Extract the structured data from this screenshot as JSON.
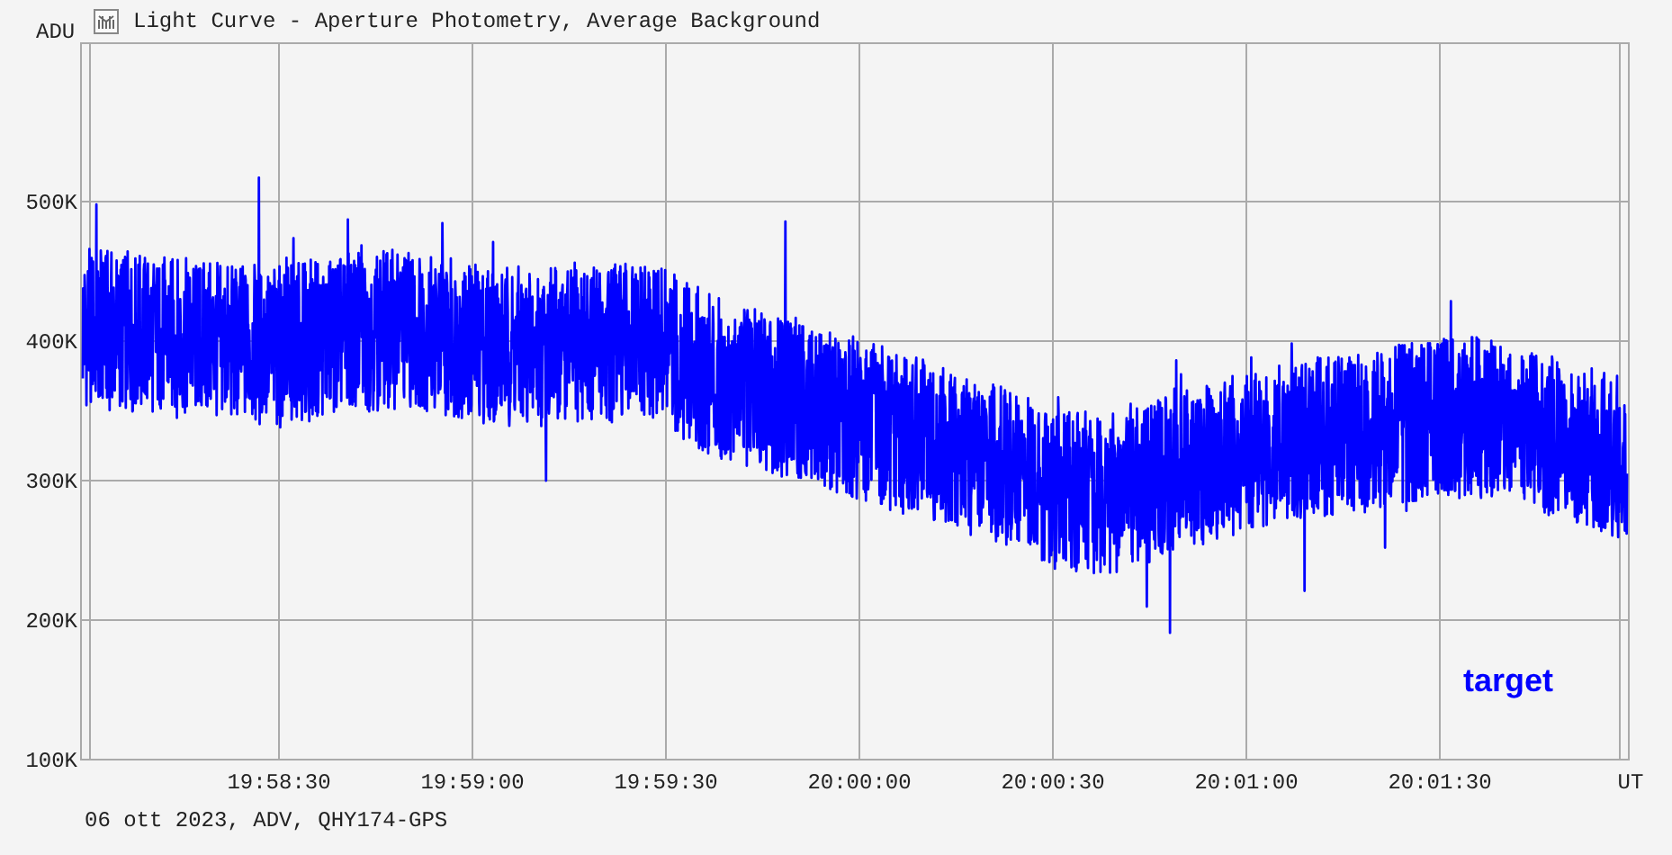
{
  "window": {
    "title": "Light Curve - Aperture Photometry, Average Background"
  },
  "chart": {
    "y_axis_title": "ADU",
    "x_axis_title": "UT",
    "y_tick_labels": [
      "500K",
      "400K",
      "300K",
      "200K",
      "100K"
    ],
    "x_tick_labels": [
      "19:58:30",
      "19:59:00",
      "19:59:30",
      "20:00:00",
      "20:00:30",
      "20:01:00",
      "20:01:30"
    ],
    "legend": [
      {
        "label": "target",
        "color": "#0000ff"
      }
    ]
  },
  "footer": "06 ott 2023, ADV, QHY174-GPS"
}
